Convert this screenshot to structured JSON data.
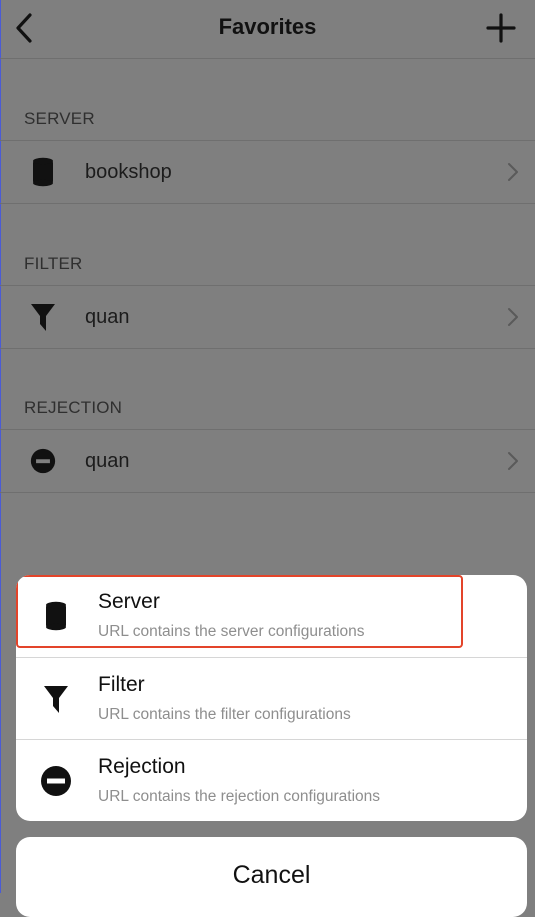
{
  "navbar": {
    "title": "Favorites",
    "back_icon": "chevron-left-icon",
    "add_icon": "plus-icon"
  },
  "sections": [
    {
      "header": "SERVER",
      "item": {
        "label": "bookshop",
        "icon": "database-icon"
      }
    },
    {
      "header": "FILTER",
      "item": {
        "label": "quan",
        "icon": "funnel-icon"
      }
    },
    {
      "header": "REJECTION",
      "item": {
        "label": "quan",
        "icon": "minus-circle-icon"
      }
    }
  ],
  "action_sheet": {
    "items": [
      {
        "title": "Server",
        "subtitle": "URL contains the server configurations",
        "icon": "database-icon"
      },
      {
        "title": "Filter",
        "subtitle": "URL contains the filter configurations",
        "icon": "funnel-icon"
      },
      {
        "title": "Rejection",
        "subtitle": "URL contains the rejection configurations",
        "icon": "minus-circle-icon"
      }
    ],
    "cancel_label": "Cancel",
    "highlight_color": "#e3442a"
  }
}
